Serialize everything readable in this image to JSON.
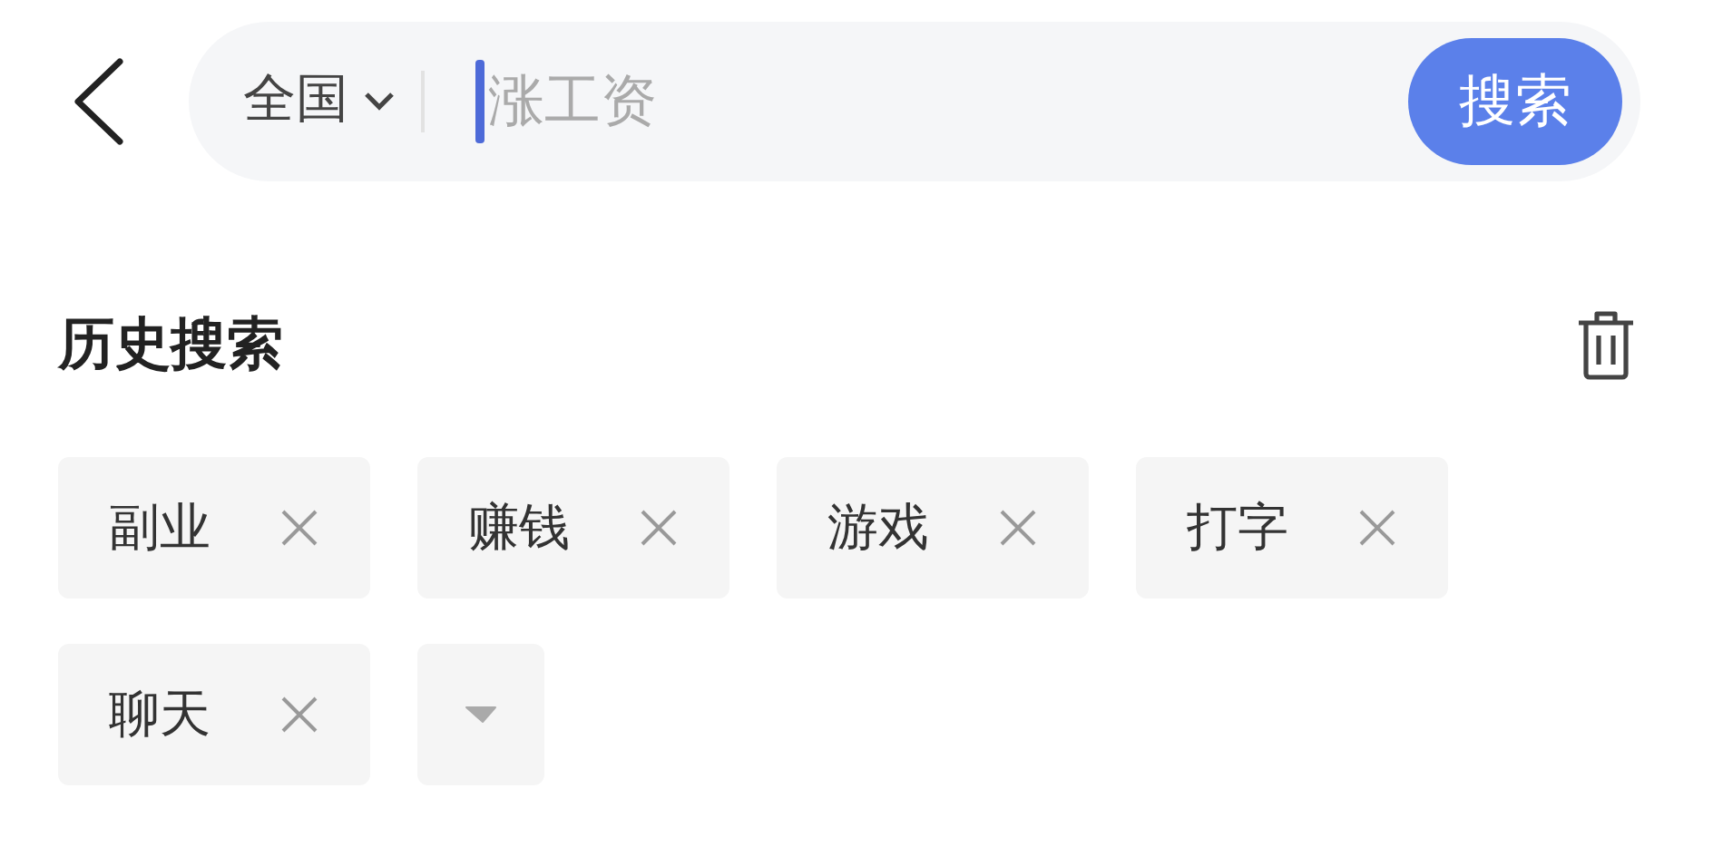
{
  "search_bar": {
    "region": "全国",
    "placeholder": "涨工资",
    "button": "搜索"
  },
  "history": {
    "title": "历史搜索",
    "tags": [
      {
        "label": "副业",
        "kind": "tag"
      },
      {
        "label": "赚钱",
        "kind": "tag"
      },
      {
        "label": "游戏",
        "kind": "tag"
      },
      {
        "label": "打字",
        "kind": "tag"
      },
      {
        "label": "聊天",
        "kind": "tag"
      },
      {
        "kind": "expand"
      }
    ]
  }
}
